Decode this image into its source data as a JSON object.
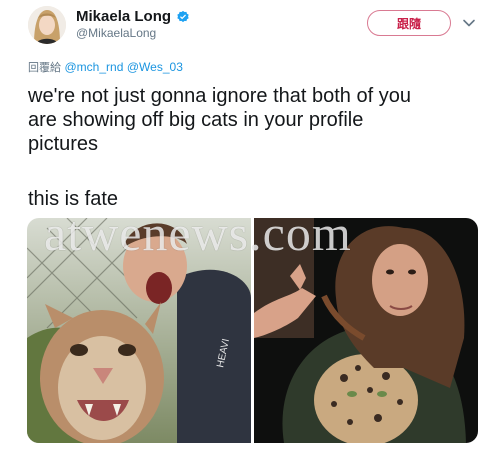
{
  "author": {
    "display_name": "Mikaela Long",
    "handle": "@MikaelaLong",
    "avatar": "avatar-photo",
    "verified_icon": "verified-badge-icon"
  },
  "follow_button": {
    "label": "跟隨"
  },
  "menu_icon": "chevron-down-icon",
  "reply": {
    "prefix": "回覆給",
    "mentions": [
      "@mch_rnd",
      "@Wes_03"
    ]
  },
  "tweet": {
    "text": "we're not just gonna ignore that both of you\nare showing off big cats in your profile\npictures",
    "text2": "this is fate"
  },
  "media": {
    "photo_left": "man-with-cougar-photo",
    "photo_right": "woman-with-leopard-shirt-photo",
    "shirt_text": "HEAVI"
  },
  "watermark": "atwenews.com",
  "colors": {
    "verified": "#1da1f2",
    "follow_accent": "#c9214a",
    "mention": "#1b95e0",
    "secondary_text": "#657786"
  }
}
